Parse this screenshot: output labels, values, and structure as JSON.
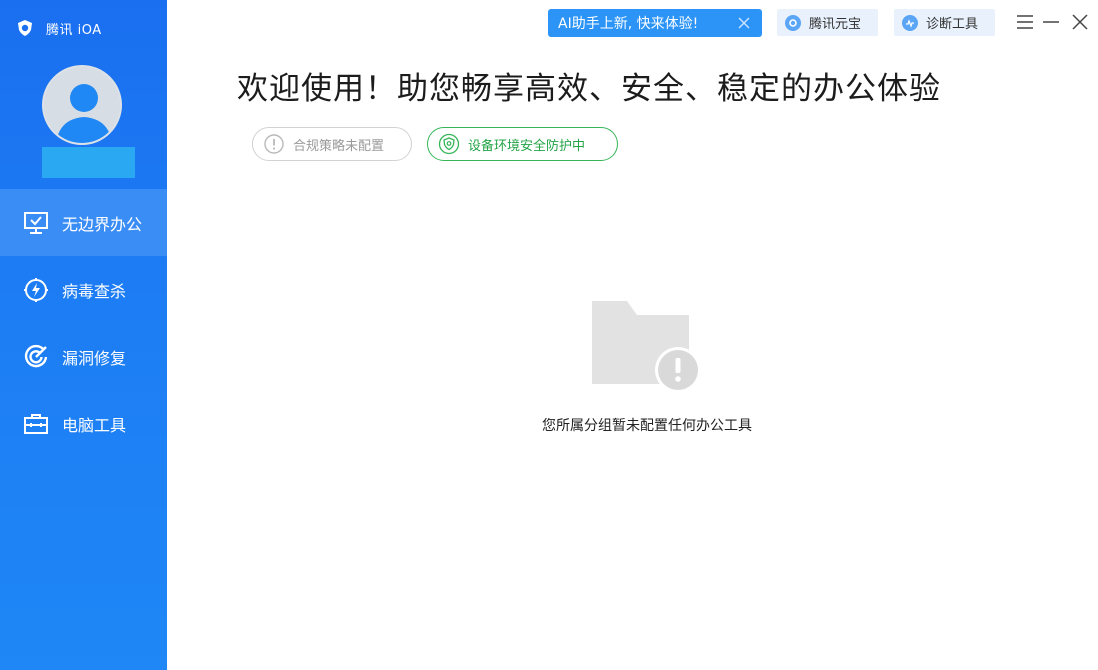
{
  "app": {
    "title": "腾讯 iOA"
  },
  "sidebar": {
    "items": [
      {
        "label": "无边界办公",
        "icon": "monitor-check-icon",
        "active": true
      },
      {
        "label": "病毒查杀",
        "icon": "virus-scan-icon",
        "active": false
      },
      {
        "label": "漏洞修复",
        "icon": "vulnerability-target-icon",
        "active": false
      },
      {
        "label": "电脑工具",
        "icon": "toolbox-icon",
        "active": false
      }
    ]
  },
  "topbar": {
    "ai_banner": "AI助手上新, 快来体验!",
    "yuanbao_label": "腾讯元宝",
    "diagnose_label": "诊断工具"
  },
  "main": {
    "welcome": "欢迎使用！助您畅享高效、安全、稳定的办公体验",
    "tags": {
      "compliance": "合规策略未配置",
      "security": "设备环境安全防护中"
    },
    "empty_message": "您所属分组暂未配置任何办公工具"
  },
  "colors": {
    "sidebar": "#1a6ff0",
    "sidebar_active": "#3b8df6",
    "ai_banner": "#2b94f6",
    "secure_green": "#23a447"
  }
}
